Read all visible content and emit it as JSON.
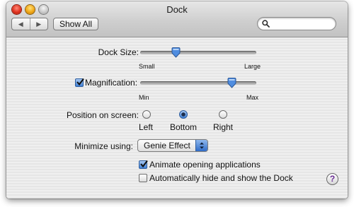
{
  "window": {
    "title": "Dock"
  },
  "toolbar": {
    "back_glyph": "◀",
    "forward_glyph": "▶",
    "show_all_label": "Show All",
    "search_value": "",
    "search_placeholder": ""
  },
  "dock_size": {
    "label": "Dock Size:",
    "min_label": "Small",
    "max_label": "Large",
    "value": 0.31
  },
  "magnification": {
    "label": "Magnification:",
    "checked": true,
    "min_label": "Min",
    "max_label": "Max",
    "value": 0.79
  },
  "position": {
    "label": "Position on screen:",
    "options": [
      {
        "label": "Left",
        "selected": false
      },
      {
        "label": "Bottom",
        "selected": true
      },
      {
        "label": "Right",
        "selected": false
      }
    ]
  },
  "minimize": {
    "label": "Minimize using:",
    "selected": "Genie Effect"
  },
  "options": {
    "animate_label": "Animate opening applications",
    "animate_checked": true,
    "autohide_label": "Automatically hide and show the Dock",
    "autohide_checked": false
  },
  "help": {
    "glyph": "?"
  },
  "colors": {
    "accent": "#3f7fd4",
    "close": "#e0321f",
    "minimize": "#f0a616",
    "zoom": "#c9c9c9",
    "help": "#6a2c95"
  },
  "icons": {
    "search": "magnifier-icon",
    "check": "checkmark-icon",
    "help": "question-mark-icon"
  }
}
